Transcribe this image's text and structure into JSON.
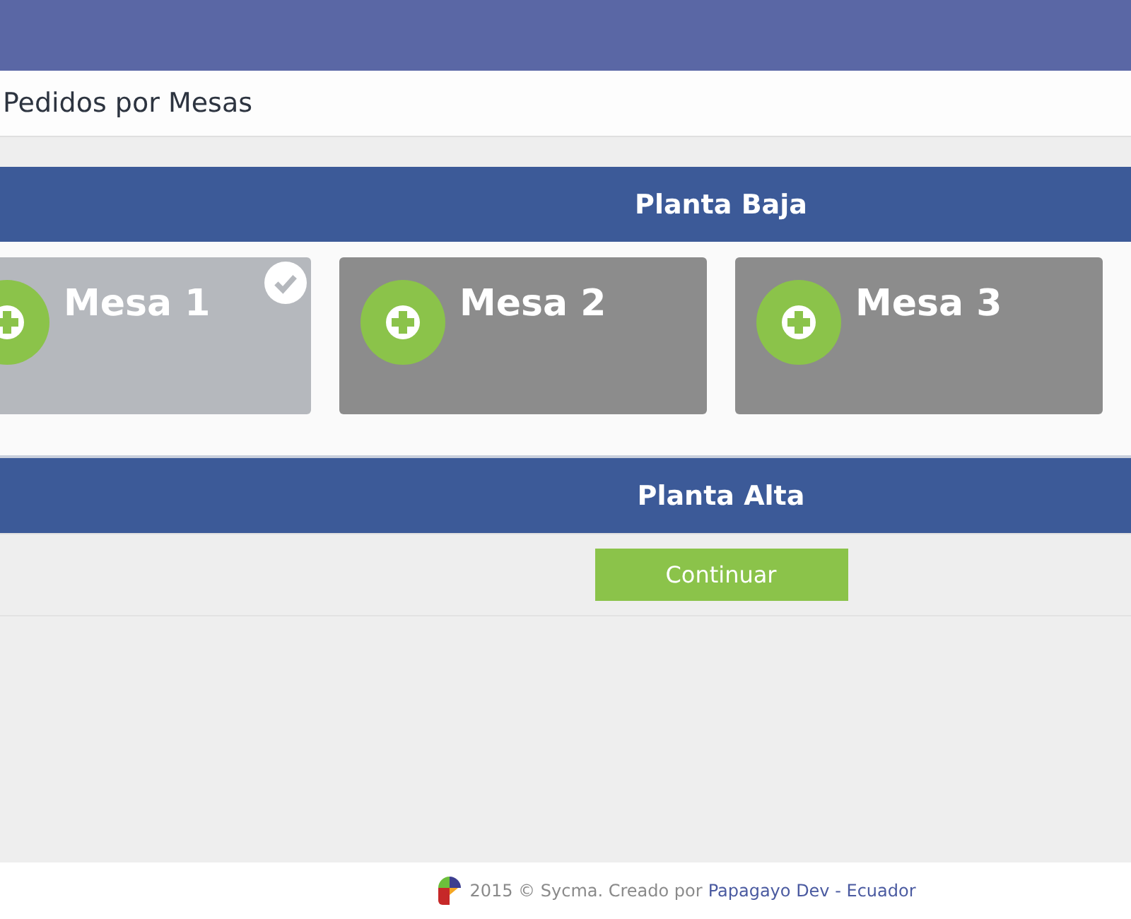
{
  "page_title": "Pedidos por Mesas",
  "floors": [
    {
      "name": "Planta Baja",
      "tables": [
        {
          "name": "Mesa 1",
          "selected": true
        },
        {
          "name": "Mesa 2",
          "selected": false
        },
        {
          "name": "Mesa 3",
          "selected": false
        }
      ]
    },
    {
      "name": "Planta Alta"
    }
  ],
  "continue_button": "Continuar",
  "footer": {
    "text": "2015 © Sycma. Creado por",
    "link": "Papagayo Dev - Ecuador"
  }
}
